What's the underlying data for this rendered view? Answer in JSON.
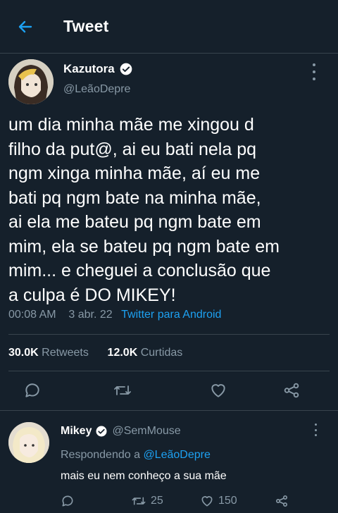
{
  "header": {
    "title": "Tweet",
    "back_icon": "arrow-left-icon"
  },
  "tweet": {
    "author_name": "Kazutora",
    "handle": "@LeãoDepre",
    "verified": true,
    "lines": [
      "um dia minha mãe me xingou d",
      "filho da put@, ai eu bati nela pq",
      "ngm xinga minha mãe, aí eu me",
      "bati pq ngm bate na minha mãe,",
      "ai ela me bateu pq ngm bate em",
      "mim, ela se bateu pq ngm bate em",
      "mim... e cheguei a conclusão que",
      "a culpa é DO MIKEY!"
    ],
    "time": "00:08 AM",
    "date": "3 abr. 22",
    "source": "Twitter para Android",
    "retweets_count": "30.0K",
    "retweets_label": "Retweets",
    "likes_count": "12.0K",
    "likes_label": "Curtidas"
  },
  "actions": {
    "reply_icon": "comment-icon",
    "retweet_icon": "retweet-icon",
    "like_icon": "heart-icon",
    "share_icon": "share-icon"
  },
  "reply": {
    "author_name": "Mikey",
    "handle": "@SemMouse",
    "verified": true,
    "replying_prefix": "Respondendo a",
    "replying_to": "@LeãoDepre",
    "text": "mais eu nem conheço a sua mãe",
    "retweets": "25",
    "likes": "150"
  },
  "colors": {
    "background": "#15202b",
    "accent": "#1da1f2",
    "muted": "#8899a6",
    "divider": "#38444d"
  }
}
